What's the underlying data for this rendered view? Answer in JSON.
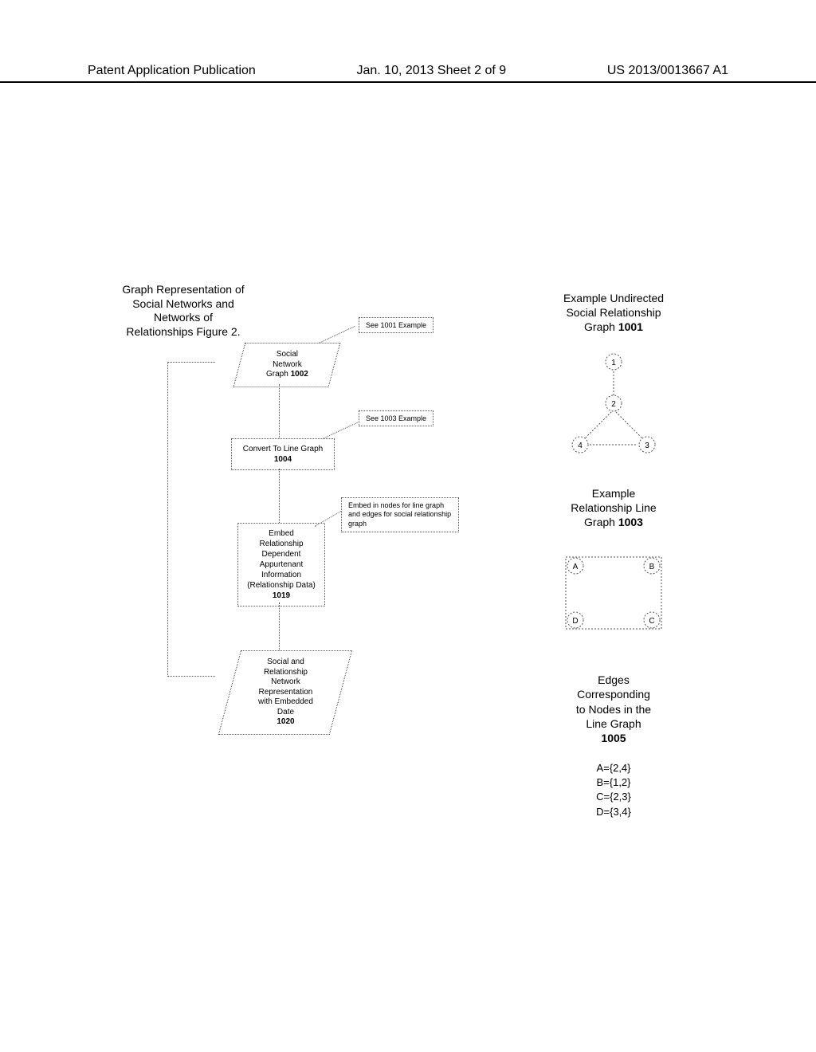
{
  "header": {
    "left": "Patent Application Publication",
    "center": "Jan. 10, 2013  Sheet 2 of 9",
    "right": "US 2013/0013667 A1"
  },
  "figure_title": "Graph Representation of Social Networks and Networks of Relationships Figure 2.",
  "flow": {
    "box_1002": {
      "line1": "Social",
      "line2": "Network",
      "line3": "Graph ",
      "ref": "1002"
    },
    "callout_1001": "See 1001 Example",
    "box_1004": {
      "line1": "Convert To Line Graph",
      "ref": "1004"
    },
    "callout_1003": "See 1003 Example",
    "box_1019": {
      "l1": "Embed",
      "l2": "Relationship",
      "l3": "Dependent",
      "l4": "Appurtenant",
      "l5": "Information",
      "l6": "(Relationship Data)",
      "ref": "1019"
    },
    "callout_embed": "Embed in nodes for line graph and edges for social relationship graph",
    "box_1020": {
      "l1": "Social and",
      "l2": "Relationship",
      "l3": "Network",
      "l4": "Representation",
      "l5": "with Embedded",
      "l6": "Date",
      "ref": "1020"
    }
  },
  "right": {
    "title_1001": {
      "l1": "Example Undirected",
      "l2": "Social Relationship",
      "l3": "Graph ",
      "ref": "1001"
    },
    "graph_1001_nodes": [
      "1",
      "2",
      "3",
      "4"
    ],
    "title_1003": {
      "l1": "Example",
      "l2": "Relationship Line",
      "l3": "Graph ",
      "ref": "1003"
    },
    "graph_1003_nodes": [
      "A",
      "B",
      "C",
      "D"
    ],
    "title_1005": {
      "l1": "Edges",
      "l2": "Corresponding",
      "l3": "to Nodes in the",
      "l4": "Line Graph",
      "ref": "1005"
    },
    "edges_1005": {
      "a": "A={2,4}",
      "b": "B={1,2}",
      "c": "C={2,3}",
      "d": "D={3,4}"
    }
  },
  "chart_data": [
    {
      "type": "graph",
      "id": "1001",
      "title": "Example Undirected Social Relationship Graph",
      "nodes": [
        "1",
        "2",
        "3",
        "4"
      ],
      "edges": [
        [
          "1",
          "2"
        ],
        [
          "2",
          "3"
        ],
        [
          "2",
          "4"
        ],
        [
          "3",
          "4"
        ]
      ]
    },
    {
      "type": "graph",
      "id": "1003",
      "title": "Example Relationship Line Graph",
      "nodes": [
        "A",
        "B",
        "C",
        "D"
      ],
      "edges": [
        [
          "A",
          "B"
        ],
        [
          "B",
          "C"
        ],
        [
          "C",
          "D"
        ],
        [
          "A",
          "D"
        ]
      ]
    },
    {
      "type": "mapping",
      "id": "1005",
      "title": "Edges Corresponding to Nodes in the Line Graph",
      "map": {
        "A": [
          2,
          4
        ],
        "B": [
          1,
          2
        ],
        "C": [
          2,
          3
        ],
        "D": [
          3,
          4
        ]
      }
    }
  ]
}
